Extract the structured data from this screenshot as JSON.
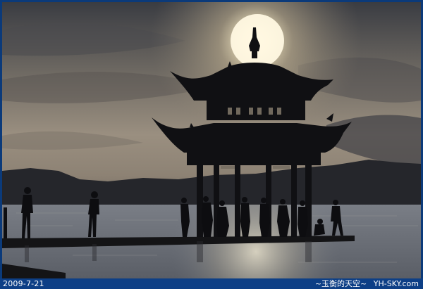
{
  "caption": {
    "date": "2009-7-21",
    "blog_name": "~玉衡的天空~",
    "site": "YH-SKY.com"
  },
  "colors": {
    "frame": "#0b3a7a",
    "sky_top": "#3c3e44",
    "sky_mid": "#8a8276",
    "sky_glow": "#f2e9cf",
    "water": "#6f747d",
    "silhouette": "#0f0f12"
  }
}
